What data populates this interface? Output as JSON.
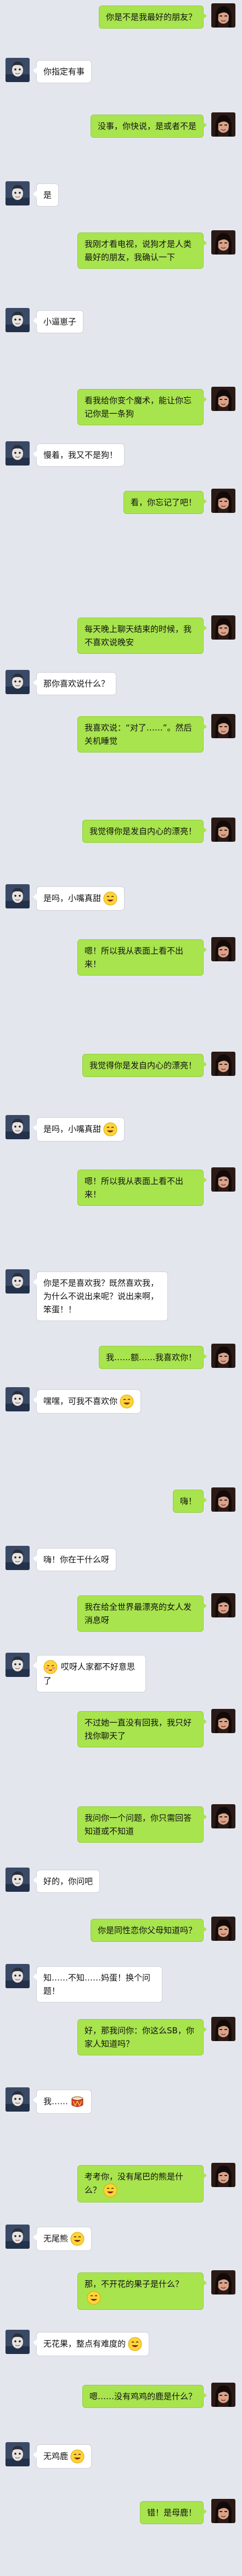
{
  "colors": {
    "background": "#e4e6ee",
    "sent_bubble": "#a8e44e",
    "received_bubble": "#ffffff"
  },
  "messages": [
    {
      "side": "right",
      "text": "你是不是我最好的朋友？"
    },
    {
      "side": "left",
      "text": "你指定有事"
    },
    {
      "side": "right",
      "text": "没事，你快说，是或者不是"
    },
    {
      "side": "left",
      "text": "是"
    },
    {
      "side": "right",
      "text": "我刚才看电视，说狗才是人类最好的朋友，我确认一下"
    },
    {
      "side": "left",
      "text": "小逼崽子"
    },
    {
      "side": "right",
      "text": "看我给你变个魔术，能让你忘记你是一条狗"
    },
    {
      "side": "left",
      "text": "慢着，我又不是狗！"
    },
    {
      "side": "right",
      "text": "看，你忘记了吧！"
    },
    {
      "side": "right",
      "text": "每天晚上聊天结束的时候，我不喜欢说晚安"
    },
    {
      "side": "left",
      "text": "那你喜欢说什么？"
    },
    {
      "side": "right",
      "text": "我喜欢说：“对了……”。然后关机睡觉"
    },
    {
      "side": "right",
      "text": "我觉得你是发自内心的漂亮！"
    },
    {
      "side": "left",
      "text": "是吗，小嘴真甜",
      "emoji": "grin-emoji"
    },
    {
      "side": "right",
      "text": "嗯！所以我从表面上看不出来！"
    },
    {
      "side": "right",
      "text": "我觉得你是发自内心的漂亮！"
    },
    {
      "side": "left",
      "text": "是吗，小嘴真甜",
      "emoji": "grin-emoji"
    },
    {
      "side": "right",
      "text": "嗯！所以我从表面上看不出来！"
    },
    {
      "side": "left",
      "text": "你是不是喜欢我？既然喜欢我，为什么不说出来呢？说出来啊，笨蛋！！"
    },
    {
      "side": "right",
      "text": "我……额……我喜欢你！"
    },
    {
      "side": "left",
      "text": "嘿嘿，可我不喜欢你",
      "emoji": "grin-emoji"
    },
    {
      "side": "right",
      "text": "嗨！"
    },
    {
      "side": "left",
      "text": "嗨！你在干什么呀"
    },
    {
      "side": "right",
      "text": "我在给全世界最漂亮的女人发消息呀"
    },
    {
      "side": "left",
      "text": "哎呀人家都不好意思了",
      "emoji": "shy-emoji",
      "emoji_first": true
    },
    {
      "side": "right",
      "text": "不过她一直没有回我，我只好找你聊天了"
    },
    {
      "side": "right",
      "text": "我问你一个问题，你只需回答知道或不知道"
    },
    {
      "side": "left",
      "text": "好的，你问吧"
    },
    {
      "side": "right",
      "text": "你是同性恋你父母知道吗？"
    },
    {
      "side": "left",
      "text": "知……不知……妈蛋！换个问题！"
    },
    {
      "side": "right",
      "text": "好，那我问你：你这么SB，你家人知道吗？"
    },
    {
      "side": "left",
      "text": "我……",
      "emoji": "drum-emoji"
    },
    {
      "side": "right",
      "text": "考考你，没有尾巴的熊是什么？",
      "emoji": "grin-emoji"
    },
    {
      "side": "left",
      "text": "无尾熊",
      "emoji": "grin-emoji"
    },
    {
      "side": "right",
      "text": "那，不开花的果子是什么？",
      "emoji": "grin-emoji"
    },
    {
      "side": "left",
      "text": "无花果，整点有难度的",
      "emoji": "grin-emoji"
    },
    {
      "side": "right",
      "text": "嗯……没有鸡鸡的鹿是什么？"
    },
    {
      "side": "left",
      "text": "无鸡鹿",
      "emoji": "grin-emoji"
    },
    {
      "side": "right",
      "text": "错！是母鹿！"
    }
  ]
}
